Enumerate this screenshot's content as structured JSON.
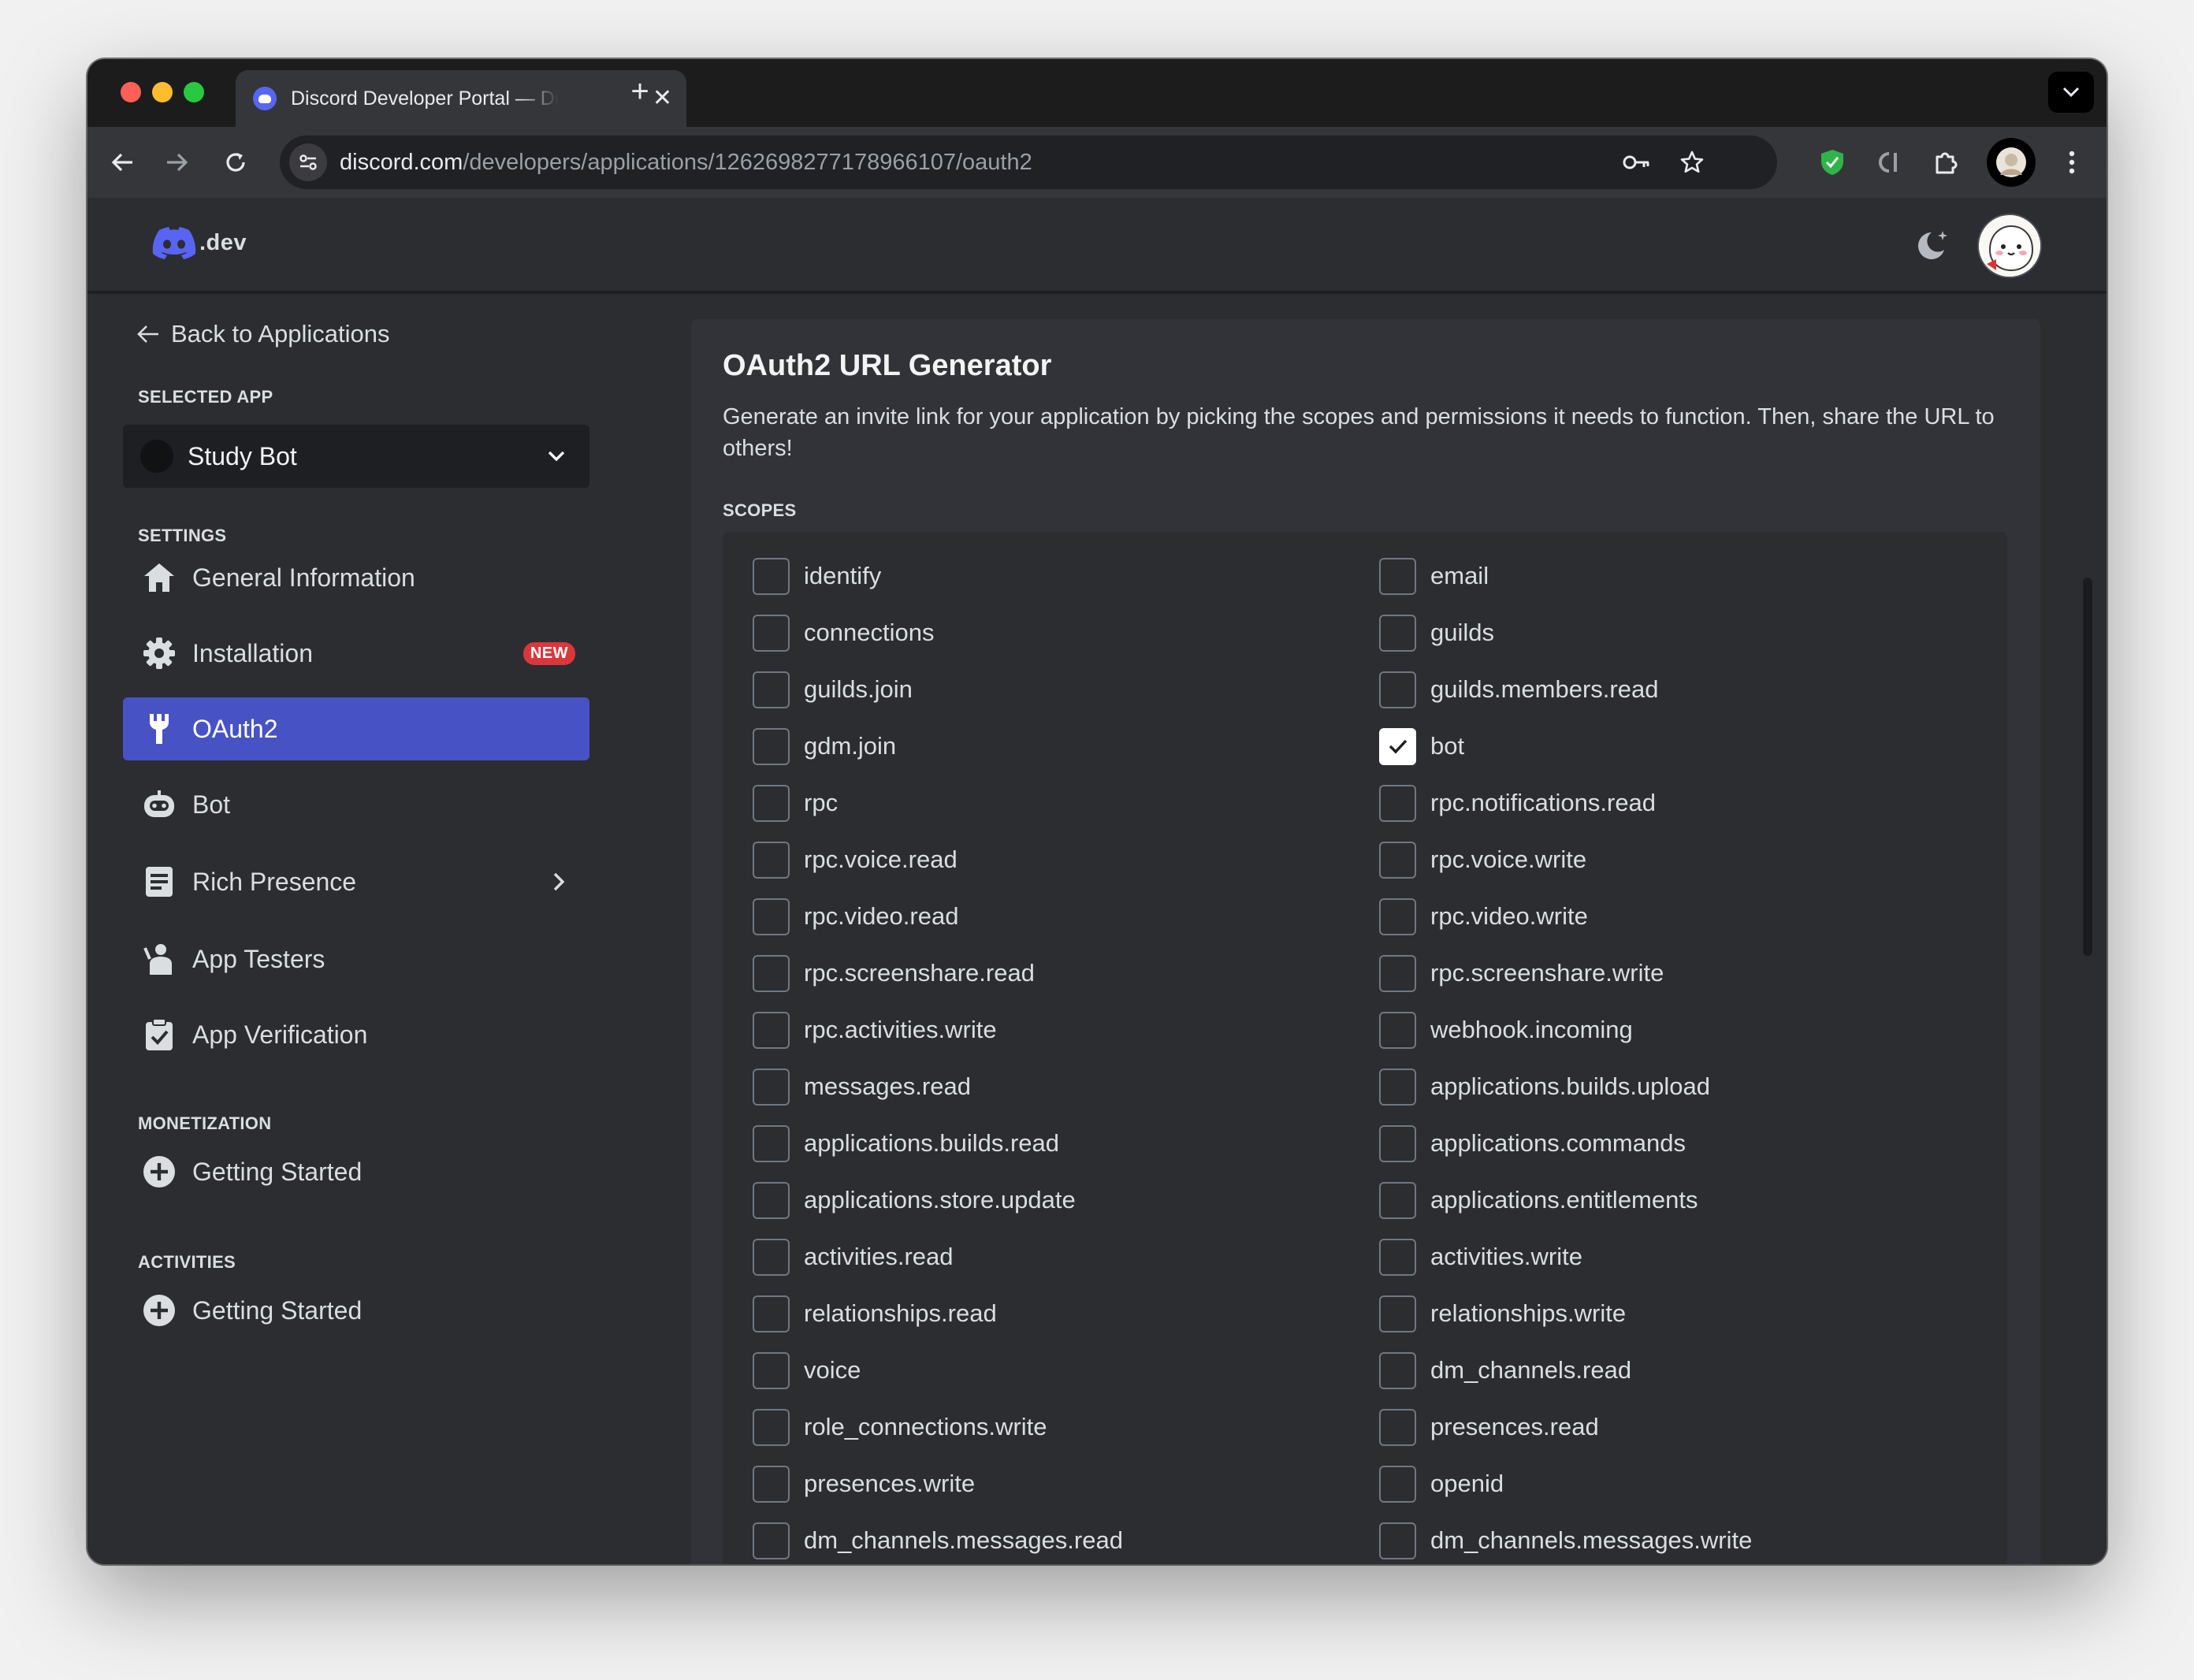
{
  "browser": {
    "tab_title": "Discord Developer Portal — Discord",
    "tab_close": "✕",
    "new_tab": "+",
    "url_host": "discord.com",
    "url_path": "/developers/applications/1262698277178966107/oauth2"
  },
  "header": {
    "logo_text": ".dev"
  },
  "sidebar": {
    "back_label": "Back to Applications",
    "selected_app_label": "SELECTED APP",
    "selected_app": "Study Bot",
    "settings_label": "SETTINGS",
    "items": [
      {
        "label": "General Information"
      },
      {
        "label": "Installation",
        "badge": "NEW"
      },
      {
        "label": "OAuth2"
      },
      {
        "label": "Bot"
      },
      {
        "label": "Rich Presence"
      },
      {
        "label": "App Testers"
      },
      {
        "label": "App Verification"
      }
    ],
    "monetization_label": "MONETIZATION",
    "monetization_item": "Getting Started",
    "activities_label": "ACTIVITIES",
    "activities_item": "Getting Started"
  },
  "main": {
    "title": "OAuth2 URL Generator",
    "description": "Generate an invite link for your application by picking the scopes and permissions it needs to function. Then, share the URL to others!",
    "scopes_label": "SCOPES",
    "scopes": [
      {
        "label": "identify",
        "checked": false
      },
      {
        "label": "email",
        "checked": false
      },
      {
        "label": "connections",
        "checked": false
      },
      {
        "label": "guilds",
        "checked": false
      },
      {
        "label": "guilds.join",
        "checked": false
      },
      {
        "label": "guilds.members.read",
        "checked": false
      },
      {
        "label": "gdm.join",
        "checked": false
      },
      {
        "label": "bot",
        "checked": true
      },
      {
        "label": "rpc",
        "checked": false
      },
      {
        "label": "rpc.notifications.read",
        "checked": false
      },
      {
        "label": "rpc.voice.read",
        "checked": false
      },
      {
        "label": "rpc.voice.write",
        "checked": false
      },
      {
        "label": "rpc.video.read",
        "checked": false
      },
      {
        "label": "rpc.video.write",
        "checked": false
      },
      {
        "label": "rpc.screenshare.read",
        "checked": false
      },
      {
        "label": "rpc.screenshare.write",
        "checked": false
      },
      {
        "label": "rpc.activities.write",
        "checked": false
      },
      {
        "label": "webhook.incoming",
        "checked": false
      },
      {
        "label": "messages.read",
        "checked": false
      },
      {
        "label": "applications.builds.upload",
        "checked": false
      },
      {
        "label": "applications.builds.read",
        "checked": false
      },
      {
        "label": "applications.commands",
        "checked": false
      },
      {
        "label": "applications.store.update",
        "checked": false
      },
      {
        "label": "applications.entitlements",
        "checked": false
      },
      {
        "label": "activities.read",
        "checked": false
      },
      {
        "label": "activities.write",
        "checked": false
      },
      {
        "label": "relationships.read",
        "checked": false
      },
      {
        "label": "relationships.write",
        "checked": false
      },
      {
        "label": "voice",
        "checked": false
      },
      {
        "label": "dm_channels.read",
        "checked": false
      },
      {
        "label": "role_connections.write",
        "checked": false
      },
      {
        "label": "presences.read",
        "checked": false
      },
      {
        "label": "presences.write",
        "checked": false
      },
      {
        "label": "openid",
        "checked": false
      },
      {
        "label": "dm_channels.messages.read",
        "checked": false
      },
      {
        "label": "dm_channels.messages.write",
        "checked": false
      }
    ]
  },
  "colors": {
    "accent": "#4752c4",
    "blurple": "#5865f2",
    "badge_red": "#da373c"
  }
}
